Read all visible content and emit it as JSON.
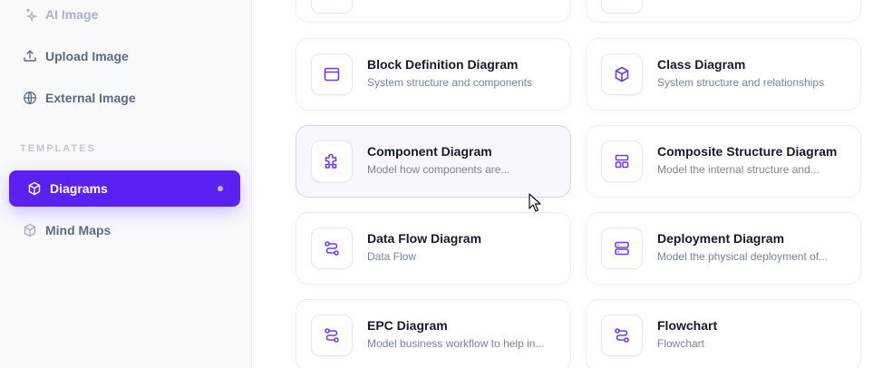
{
  "colors": {
    "accent": "#5b21f2",
    "icon": "#6d3bf0"
  },
  "sidebar": {
    "items_top": [
      {
        "label": "AI Image",
        "icon": "sparkle-icon"
      },
      {
        "label": "Upload Image",
        "icon": "upload-icon"
      },
      {
        "label": "External Image",
        "icon": "globe-icon"
      }
    ],
    "section_label": "TEMPLATES",
    "templates": [
      {
        "label": "Diagrams",
        "icon": "cube-icon",
        "active": true
      },
      {
        "label": "Mind Maps",
        "icon": "cube-icon",
        "active": false
      }
    ]
  },
  "cards": [
    {
      "title": "Block Definition Diagram",
      "desc": "System structure and components",
      "icon": "window-icon"
    },
    {
      "title": "Class Diagram",
      "desc": "System structure and relationships",
      "icon": "cube-icon"
    },
    {
      "title": "Component Diagram",
      "desc": "Model how components are...",
      "icon": "puzzle-icon"
    },
    {
      "title": "Composite Structure Diagram",
      "desc": "Model the internal structure and...",
      "icon": "layout-icon"
    },
    {
      "title": "Data Flow Diagram",
      "desc": "Data Flow",
      "icon": "flow-icon"
    },
    {
      "title": "Deployment Diagram",
      "desc": "Model the physical deployment of...",
      "icon": "server-icon"
    },
    {
      "title": "EPC Diagram",
      "desc": "Model business workflow to help in...",
      "icon": "flow-icon"
    },
    {
      "title": "Flowchart",
      "desc": "Flowchart",
      "icon": "flow-icon"
    }
  ]
}
